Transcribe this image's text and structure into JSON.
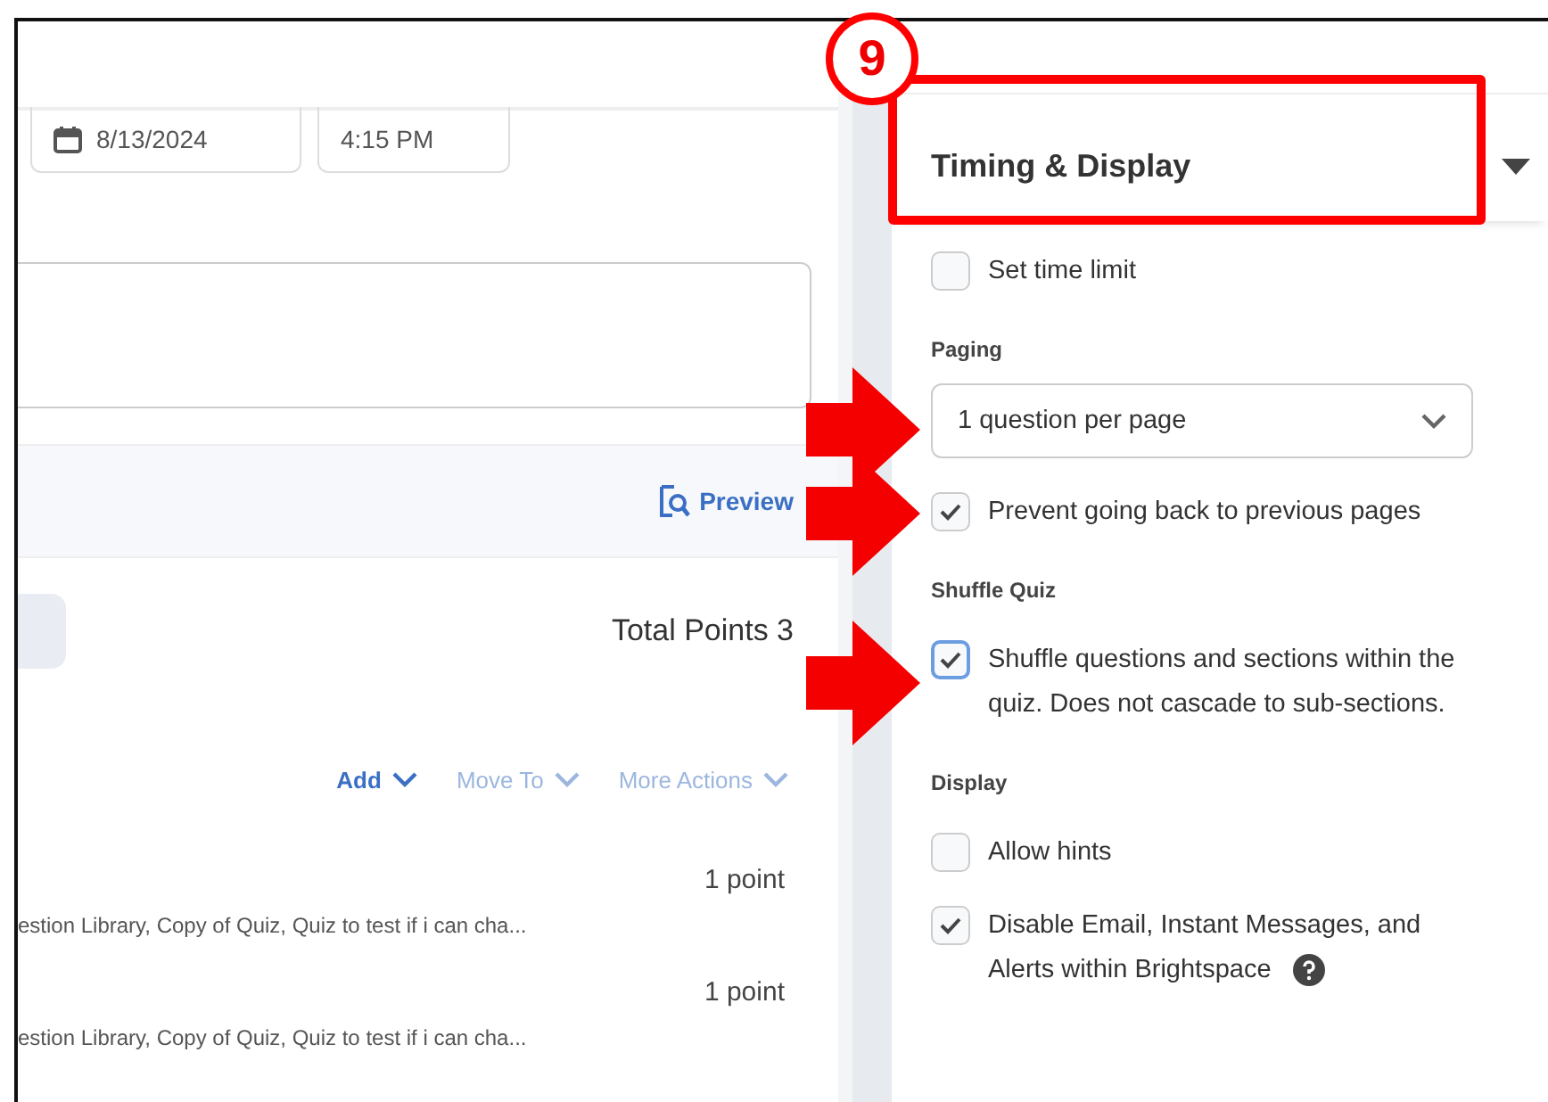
{
  "date_field": {
    "value": "8/13/2024"
  },
  "time_field": {
    "value": "4:15 PM"
  },
  "preview_link": "Preview",
  "total_points": "Total Points 3",
  "actions": [
    {
      "label": "Add",
      "disabled": false
    },
    {
      "label": "Move To",
      "disabled": true
    },
    {
      "label": "More Actions",
      "disabled": true
    }
  ],
  "questions": [
    {
      "points": "1 point",
      "sources": "estion Library, Copy of Quiz, Quiz to test if i can cha..."
    },
    {
      "points": "1 point",
      "sources": "estion Library, Copy of Quiz, Quiz to test if i can cha..."
    }
  ],
  "callout_number": "9",
  "panel": {
    "title": "Timing & Display",
    "expanded": true,
    "highlighted": true,
    "items": [
      {
        "kind": "checkbox",
        "label": "Set time limit",
        "checked": false,
        "focused": false,
        "help": false,
        "arrow": false
      },
      {
        "kind": "heading",
        "label": "Paging",
        "arrow": false
      },
      {
        "kind": "select",
        "value": "1 question per page",
        "arrow": true
      },
      {
        "kind": "checkbox",
        "label": "Prevent going back to previous pages",
        "checked": true,
        "focused": false,
        "help": false,
        "arrow": true
      },
      {
        "kind": "heading",
        "label": "Shuffle Quiz",
        "arrow": false
      },
      {
        "kind": "checkbox",
        "label": "Shuffle questions and sections within the quiz. Does not cascade to sub-sections.",
        "checked": true,
        "focused": true,
        "help": false,
        "arrow": true
      },
      {
        "kind": "heading",
        "label": "Display",
        "arrow": false
      },
      {
        "kind": "checkbox",
        "label": "Allow hints",
        "checked": false,
        "focused": false,
        "help": false,
        "arrow": false
      },
      {
        "kind": "checkbox",
        "label": "Disable Email, Instant Messages, and Alerts within Brightspace",
        "checked": true,
        "focused": false,
        "help": true,
        "arrow": false
      }
    ]
  }
}
